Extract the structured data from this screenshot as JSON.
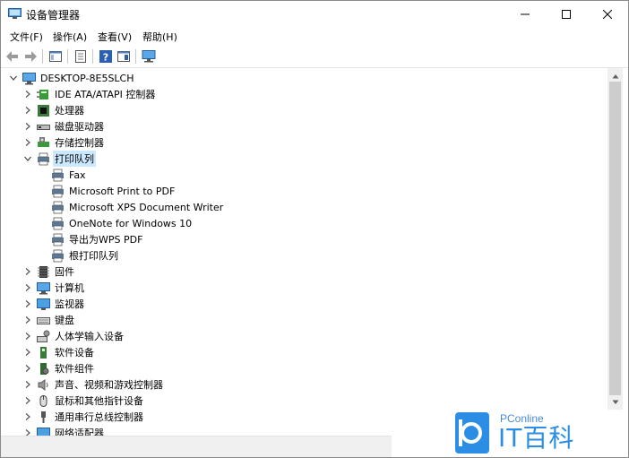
{
  "window": {
    "title": "设备管理器"
  },
  "menu": [
    "文件(F)",
    "操作(A)",
    "查看(V)",
    "帮助(H)"
  ],
  "tree": {
    "root": "DESKTOP-8E5SLCH",
    "items": [
      {
        "label": "IDE ATA/ATAPI 控制器",
        "icon": "ide-controller-icon",
        "expanded": false
      },
      {
        "label": "处理器",
        "icon": "processor-icon",
        "expanded": false
      },
      {
        "label": "磁盘驱动器",
        "icon": "disk-drive-icon",
        "expanded": false
      },
      {
        "label": "存储控制器",
        "icon": "storage-controller-icon",
        "expanded": false
      },
      {
        "label": "打印队列",
        "icon": "printer-icon",
        "expanded": true,
        "selected": true,
        "children": [
          "Fax",
          "Microsoft Print to PDF",
          "Microsoft XPS Document Writer",
          "OneNote for Windows 10",
          "导出为WPS PDF",
          "根打印队列"
        ]
      },
      {
        "label": "固件",
        "icon": "firmware-icon",
        "expanded": false
      },
      {
        "label": "计算机",
        "icon": "computer-icon",
        "expanded": false
      },
      {
        "label": "监视器",
        "icon": "monitor-icon",
        "expanded": false
      },
      {
        "label": "键盘",
        "icon": "keyboard-icon",
        "expanded": false
      },
      {
        "label": "人体学输入设备",
        "icon": "hid-icon",
        "expanded": false
      },
      {
        "label": "软件设备",
        "icon": "software-device-icon",
        "expanded": false
      },
      {
        "label": "软件组件",
        "icon": "software-component-icon",
        "expanded": false
      },
      {
        "label": "声音、视频和游戏控制器",
        "icon": "sound-icon",
        "expanded": false
      },
      {
        "label": "鼠标和其他指针设备",
        "icon": "mouse-icon",
        "expanded": false
      },
      {
        "label": "通用串行总线控制器",
        "icon": "usb-icon",
        "expanded": false
      },
      {
        "label": "网络适配器",
        "icon": "network-adapter-icon",
        "expanded": false
      }
    ]
  },
  "watermark": {
    "brand": "PConline",
    "name": "IT百科"
  },
  "colors": {
    "selection": "#cce8ff",
    "accent": "#2b8ee4"
  }
}
